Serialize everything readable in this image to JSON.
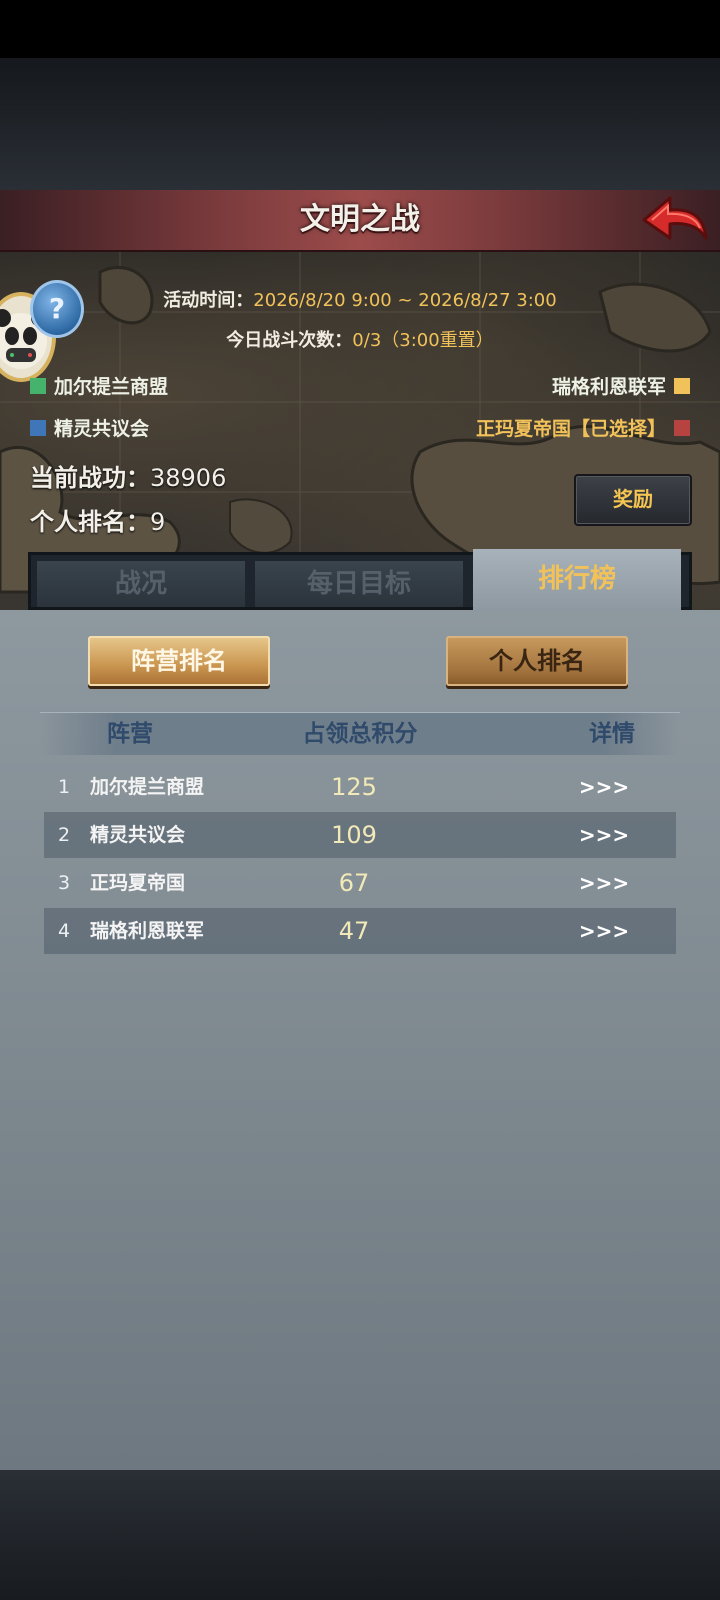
{
  "window": {
    "title": "文明之战"
  },
  "event": {
    "time_label": "活动时间：",
    "time_value": "2026/8/20 9:00 ~ 2026/8/27 3:00",
    "battles_label": "今日战斗次数：",
    "battles_value": "0/3（3:00重置）"
  },
  "factions": {
    "top_left": {
      "name": "加尔提兰商盟",
      "color": "#45b36b"
    },
    "bottom_left": {
      "name": "精灵共议会",
      "color": "#3f76b8"
    },
    "top_right": {
      "name": "瑞格利恩联军",
      "color": "#f2c25a"
    },
    "bottom_right": {
      "name": "正玛夏帝国【已选择】",
      "color": "#b6433f"
    }
  },
  "stats": {
    "merit_label": "当前战功：",
    "merit_value": "38906",
    "rank_label": "个人排名：",
    "rank_value": "9"
  },
  "reward_button": "奖励",
  "help_icon": "?",
  "tabs": [
    {
      "label": "战况",
      "active": false
    },
    {
      "label": "每日目标",
      "active": false
    },
    {
      "label": "排行榜",
      "active": true
    }
  ],
  "ranking_toggle": {
    "faction_label": "阵营排名",
    "personal_label": "个人排名"
  },
  "table": {
    "headers": [
      "阵营",
      "占领总积分",
      "详情"
    ],
    "rows": [
      {
        "rank": "1",
        "name": "加尔提兰商盟",
        "score": "125",
        "detail": ">>>"
      },
      {
        "rank": "2",
        "name": "精灵共议会",
        "score": "109",
        "detail": ">>>"
      },
      {
        "rank": "3",
        "name": "正玛夏帝国",
        "score": "67",
        "detail": ">>>"
      },
      {
        "rank": "4",
        "name": "瑞格利恩联军",
        "score": "47",
        "detail": ">>>"
      }
    ]
  }
}
